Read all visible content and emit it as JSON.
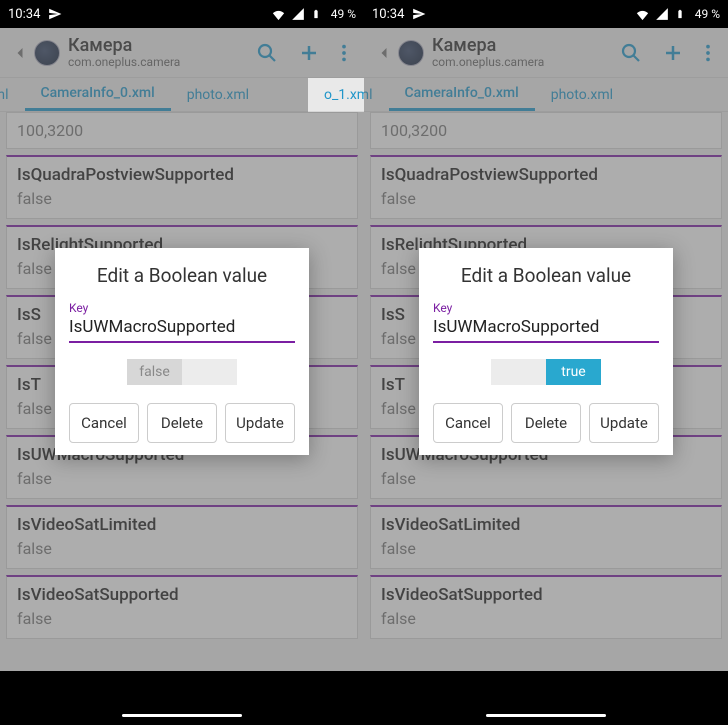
{
  "status": {
    "time": "10:34",
    "battery": "49 %"
  },
  "app": {
    "title": "Камера",
    "package": "com.oneplus.camera"
  },
  "tabs": {
    "left": "o_1.xml",
    "mid": "CameraInfo_0.xml",
    "right": "photo.xml"
  },
  "rows": [
    {
      "key": "",
      "value": "100,3200"
    },
    {
      "key": "IsQuadraPostviewSupported",
      "value": "false"
    },
    {
      "key": "IsRelightSupported",
      "value": "false"
    },
    {
      "key": "IsS",
      "value": "false"
    },
    {
      "key": "IsT",
      "value": "false"
    },
    {
      "key": "IsUWMacroSupported",
      "value": "false"
    },
    {
      "key": "IsVideoSatLimited",
      "value": "false"
    },
    {
      "key": "IsVideoSatSupported",
      "value": "false"
    }
  ],
  "dialog": {
    "title": "Edit a Boolean value",
    "field_label": "Key",
    "field_value": "IsUWMacroSupported",
    "false_label": "false",
    "true_label": "true",
    "cancel": "Cancel",
    "delete": "Delete",
    "update": "Update"
  }
}
